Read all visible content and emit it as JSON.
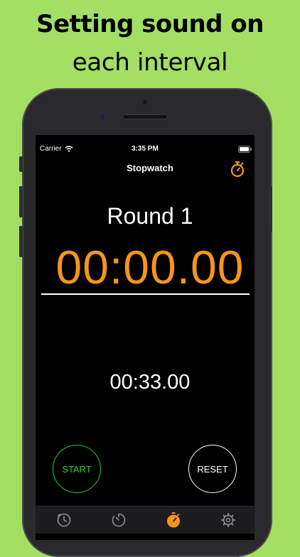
{
  "caption": {
    "line1": "Setting sound on",
    "line2": "each interval"
  },
  "status_bar": {
    "carrier": "Carrier",
    "time": "3:35 PM"
  },
  "nav": {
    "title": "Stopwatch",
    "icon": "stopwatch-icon"
  },
  "timer": {
    "round_label": "Round 1",
    "main_time": "00:00.00",
    "total_time": "00:33.00"
  },
  "controls": {
    "start_label": "START",
    "reset_label": "RESET"
  },
  "tabs": [
    {
      "icon": "clock-icon",
      "active": false
    },
    {
      "icon": "timer-icon",
      "active": false
    },
    {
      "icon": "stopwatch-icon",
      "active": true
    },
    {
      "icon": "settings-gear-icon",
      "active": false
    }
  ],
  "colors": {
    "background": "#a3df62",
    "accent": "#f7941d",
    "start": "#2ec92e",
    "screen": "#000000"
  }
}
